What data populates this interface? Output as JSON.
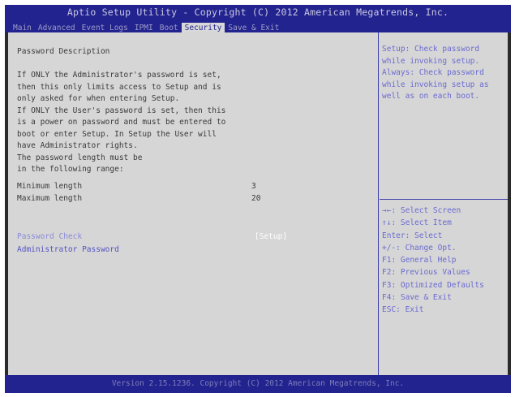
{
  "header": {
    "title": "Aptio Setup Utility - Copyright (C) 2012 American Megatrends, Inc.",
    "tabs": [
      {
        "label": "Main",
        "active": false
      },
      {
        "label": "Advanced",
        "active": false
      },
      {
        "label": "Event Logs",
        "active": false
      },
      {
        "label": "IPMI",
        "active": false
      },
      {
        "label": "Boot",
        "active": false
      },
      {
        "label": "Security",
        "active": true
      },
      {
        "label": "Save & Exit",
        "active": false
      }
    ]
  },
  "main": {
    "description_title": "Password Description",
    "description_lines": [
      "If ONLY the Administrator's password is set,",
      "then this only limits access to Setup and is",
      "only asked for when entering Setup.",
      "If ONLY the User's password is set, then this",
      "is a power on password and must be entered to",
      "boot or enter Setup. In Setup the User will",
      "have Administrator rights.",
      "The password length must be",
      "in the following range:"
    ],
    "min_length_label": "Minimum length",
    "min_length_value": "3",
    "max_length_label": "Maximum length",
    "max_length_value": "20",
    "password_check_label": "Password Check",
    "password_check_value": "[Setup]",
    "admin_password_label": "Administrator Password"
  },
  "help": {
    "lines": [
      "Setup: Check password",
      "while invoking setup.",
      "Always: Check password",
      "while invoking setup as",
      "well as on each boot."
    ],
    "keys": [
      "→←: Select Screen",
      "↑↓: Select Item",
      "Enter: Select",
      "+/-: Change Opt.",
      "F1: General Help",
      "F2: Previous Values",
      "F3: Optimized Defaults",
      "F4: Save & Exit",
      "ESC: Exit"
    ]
  },
  "footer": {
    "text": "Version 2.15.1236. Copyright (C) 2012 American Megatrends, Inc."
  },
  "colors": {
    "header_bg": "#23238f",
    "body_bg": "#d6d6d6",
    "help_text": "#6a6ad0",
    "selected_item": "#8a8ad8"
  }
}
